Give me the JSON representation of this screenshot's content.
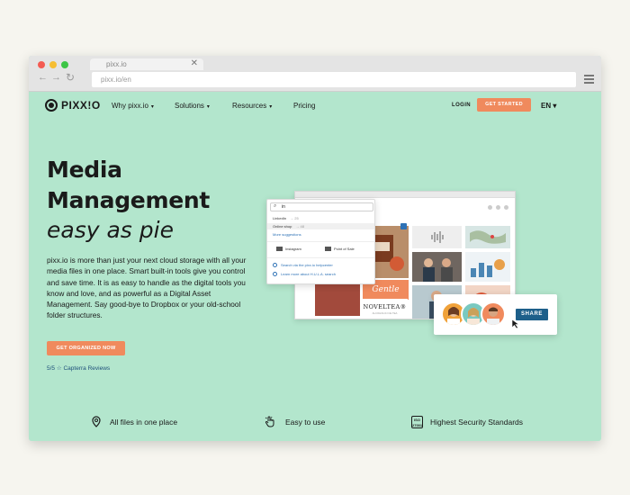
{
  "browser": {
    "tab_title": "pixx.io",
    "tab_close": "✕",
    "back": "←",
    "forward": "→",
    "url": "pixx.io/en",
    "traffic_lights": [
      "#f45b52",
      "#f6be33",
      "#3cc546"
    ]
  },
  "nav": {
    "logo": "PIXX!O",
    "links": [
      {
        "label": "Why pixx.io",
        "caret": "▾"
      },
      {
        "label": "Solutions",
        "caret": "▾"
      },
      {
        "label": "Resources",
        "caret": "▾"
      },
      {
        "label": "Pricing",
        "caret": ""
      }
    ],
    "login": "LOGIN",
    "get_started": "GET STARTED",
    "language": "EN ▾"
  },
  "hero": {
    "line1": "Media",
    "line2": "Management",
    "line3": "easy as pie",
    "description": "pixx.io is more than just your next cloud storage with all your media files in one place. Smart built-in tools give you control and save time. It is as easy to handle as the digital tools you know and love, and as powerful as a Digital Asset Management. Say good-bye to Dropbox or your old-school folder structures.",
    "cta": "GET ORGANIZED NOW",
    "reviews": "5/5 ☆ Capterra Reviews"
  },
  "features": [
    {
      "icon": "location-pin-icon",
      "label": "All files in one place"
    },
    {
      "icon": "hand-pointer-icon",
      "label": "Easy to use"
    },
    {
      "icon": "iso-badge-icon",
      "label": "Highest Security Standards",
      "badge": "ISO\n27001"
    }
  ],
  "search_popup": {
    "query": "in",
    "results": [
      {
        "label": "LinkedIn",
        "meta": "→ 25"
      },
      {
        "label": "Online shop",
        "meta": "→ 48"
      }
    ],
    "more": "More suggestions",
    "tags": [
      "Instagram",
      "Point of Sale"
    ],
    "info": [
      "Search via the pixx.io helpcenter",
      "Learn more about H.U.L.A. search"
    ]
  },
  "app_preview": {
    "brand_tile": "NOVELTEA®",
    "brand_tile_sub": "ALCOHOLIC ICE TEA",
    "script_tile": "Gentle"
  },
  "share_card": {
    "button": "SHARE"
  },
  "colors": {
    "background": "#b3e6cd",
    "accent": "#f08a5d",
    "link": "#1e4f7a",
    "share": "#1d5f8a"
  }
}
